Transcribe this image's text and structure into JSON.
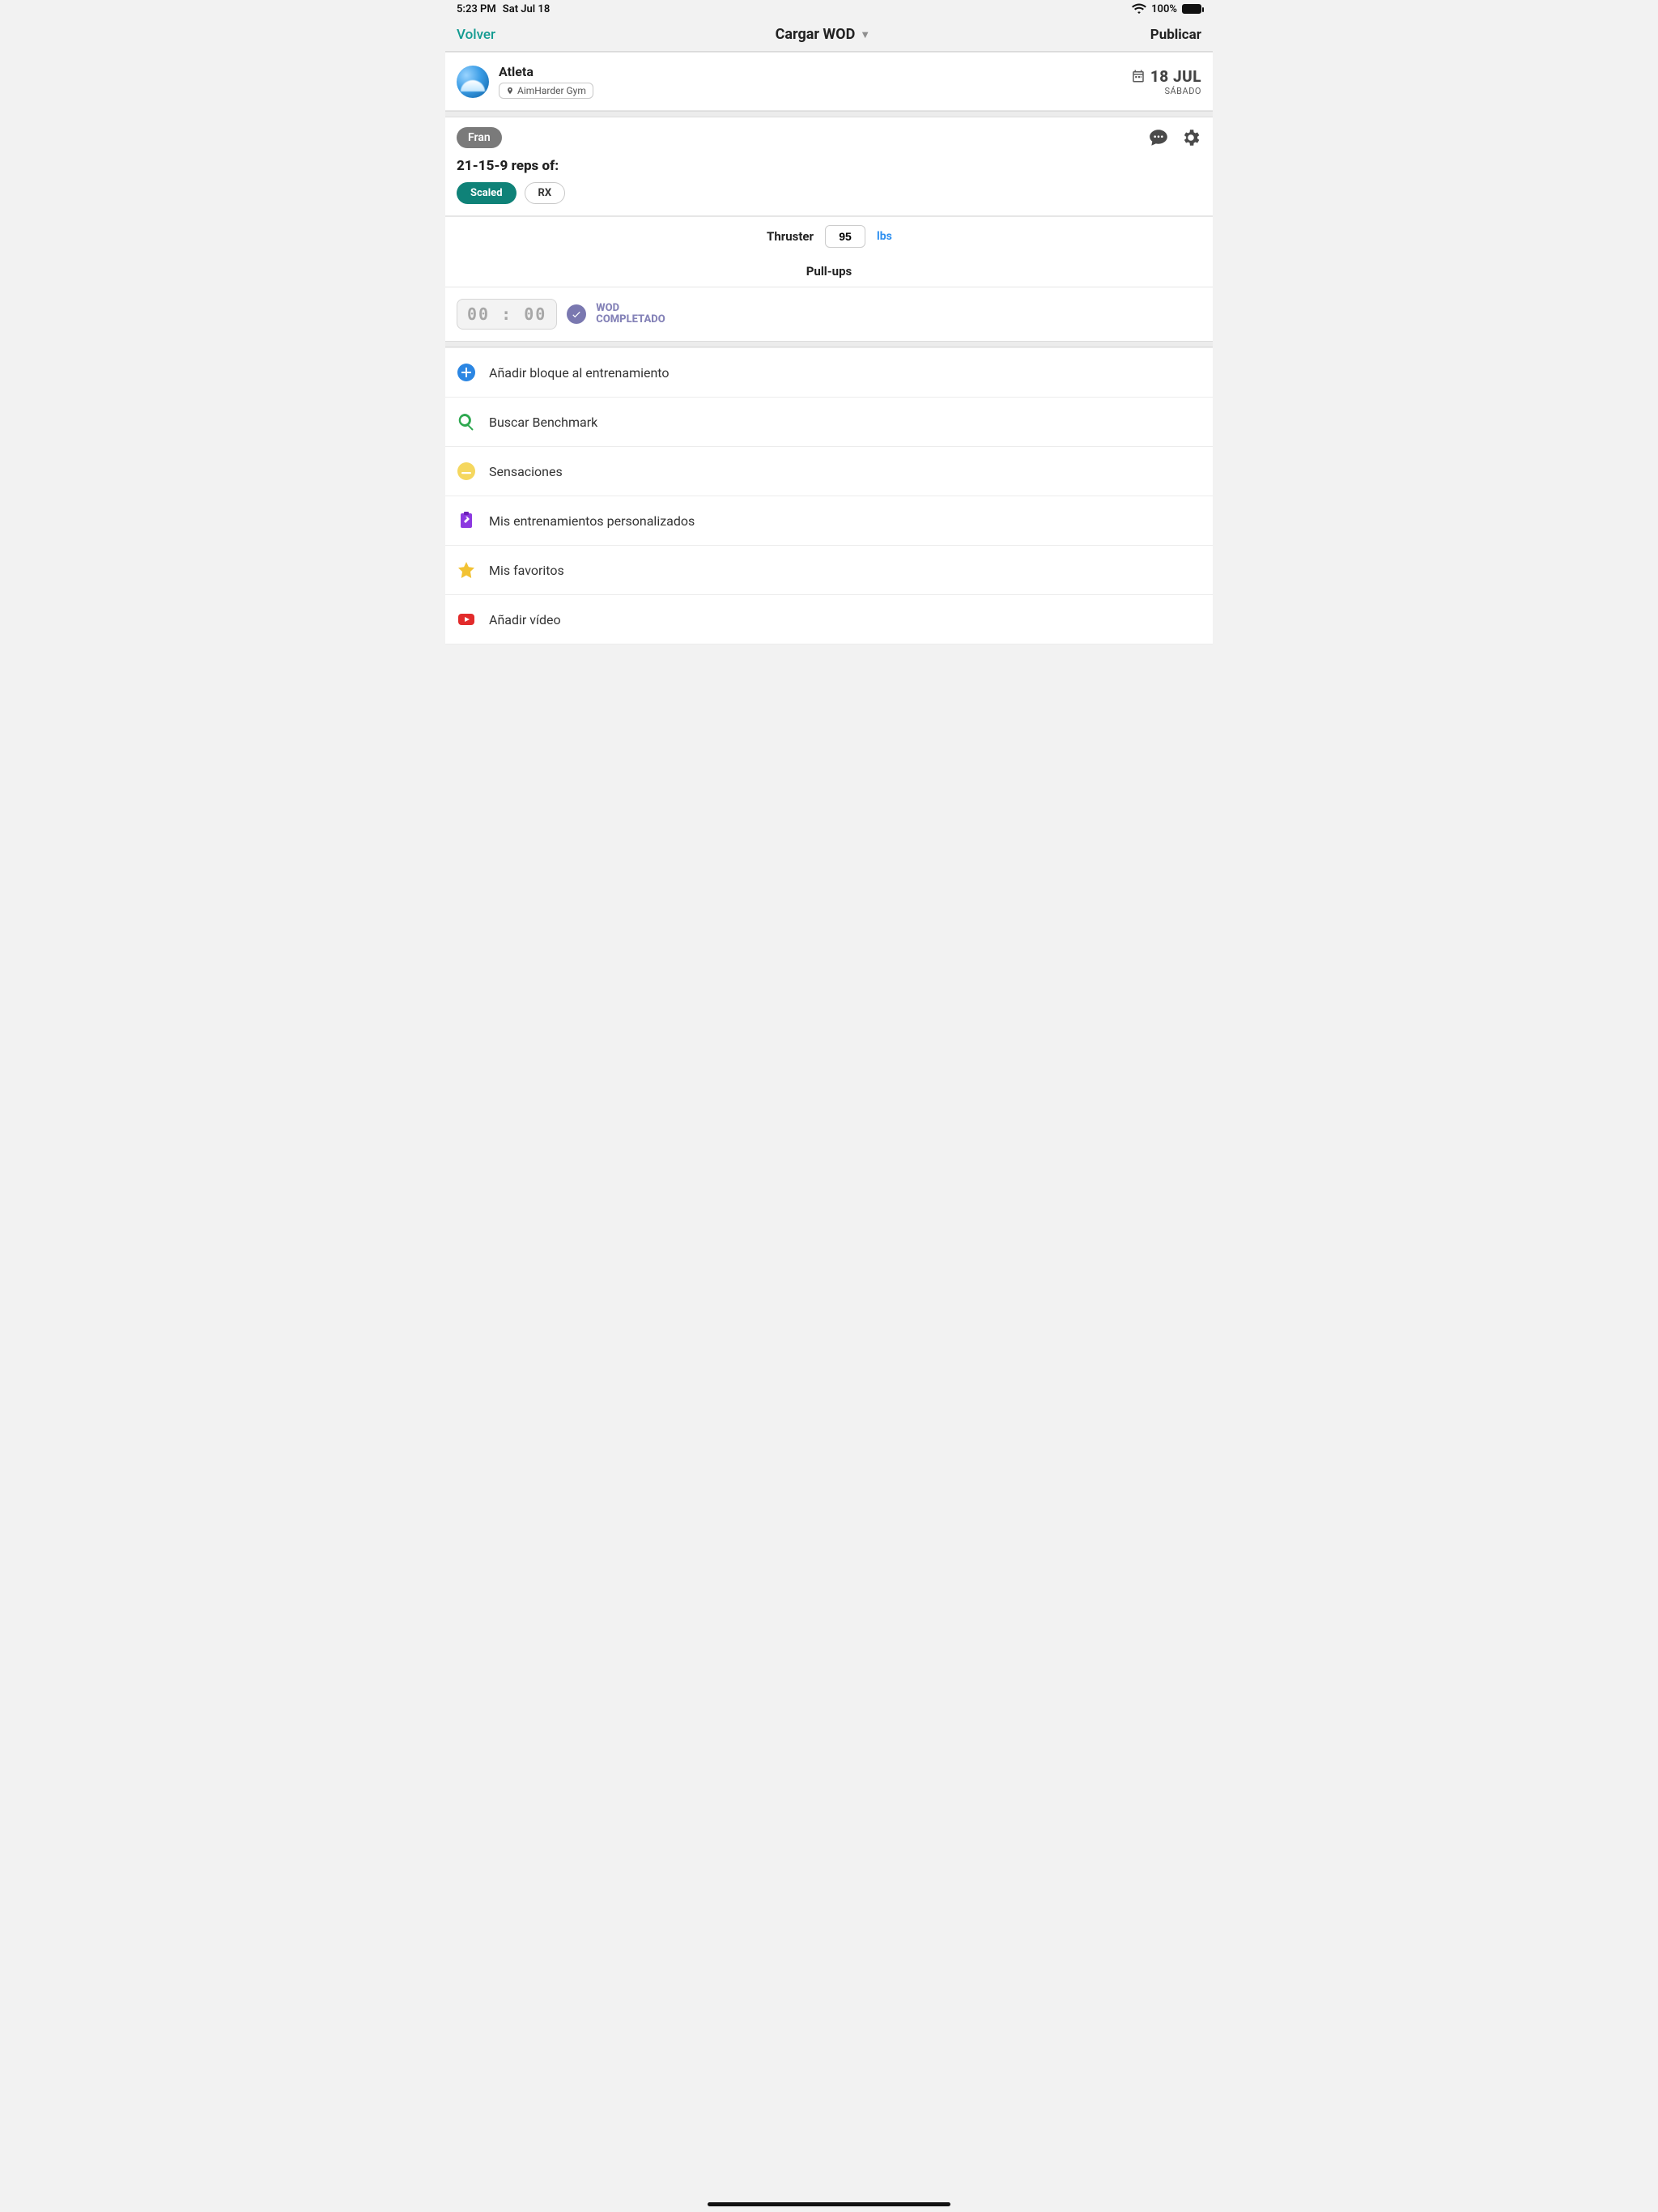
{
  "status": {
    "time": "5:23 PM",
    "date": "Sat Jul 18",
    "battery_pct": "100%"
  },
  "nav": {
    "back": "Volver",
    "title": "Cargar WOD",
    "publish": "Publicar"
  },
  "profile": {
    "name": "Atleta",
    "gym": "AimHarder Gym",
    "date_line1": "18 JUL",
    "date_line2": "SÁBADO"
  },
  "wod": {
    "tag": "Fran",
    "scheme": "21-15-9 reps of:",
    "scaling": {
      "scaled": "Scaled",
      "rx": "RX"
    },
    "movements": {
      "thruster_label": "Thruster",
      "thruster_weight": "95",
      "thruster_unit": "lbs",
      "pullups_label": "Pull-ups"
    },
    "time_value": "00 : 00",
    "completed_line1": "WOD",
    "completed_line2": "COMPLETADO"
  },
  "actions": {
    "add_block": "Añadir bloque al entrenamiento",
    "search_benchmark": "Buscar Benchmark",
    "sensations": "Sensaciones",
    "my_trainings": "Mis entrenamientos personalizados",
    "favorites": "Mis favoritos",
    "add_video": "Añadir vídeo"
  }
}
